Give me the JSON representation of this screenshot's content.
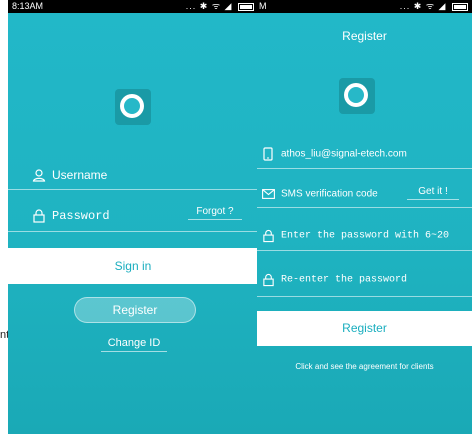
{
  "login": {
    "status_time": "8:13AM",
    "status_icons": "... ✱ ᯤ ◢",
    "username_placeholder": "Username",
    "password_placeholder": "Password",
    "forgot_label": "Forgot ?",
    "signin_label": "Sign in",
    "register_label": "Register",
    "change_id_label": "Change ID"
  },
  "register": {
    "status_fragment": "M",
    "status_icons": "... ✱ ᯤ ◢",
    "title": "Register",
    "email_value": "athos_liu@signal-etech.com",
    "sms_placeholder": "SMS verification code",
    "get_it_label": "Get it !",
    "password_placeholder": "Enter the password with 6~20",
    "reenter_placeholder": "Re-enter the password",
    "register_button_label": "Register",
    "agreement_text": "Click and see the agreement for clients"
  },
  "stray_text": "nt",
  "colors": {
    "teal": "#22b8c9",
    "accent": "#1aaebf",
    "white": "#ffffff"
  }
}
